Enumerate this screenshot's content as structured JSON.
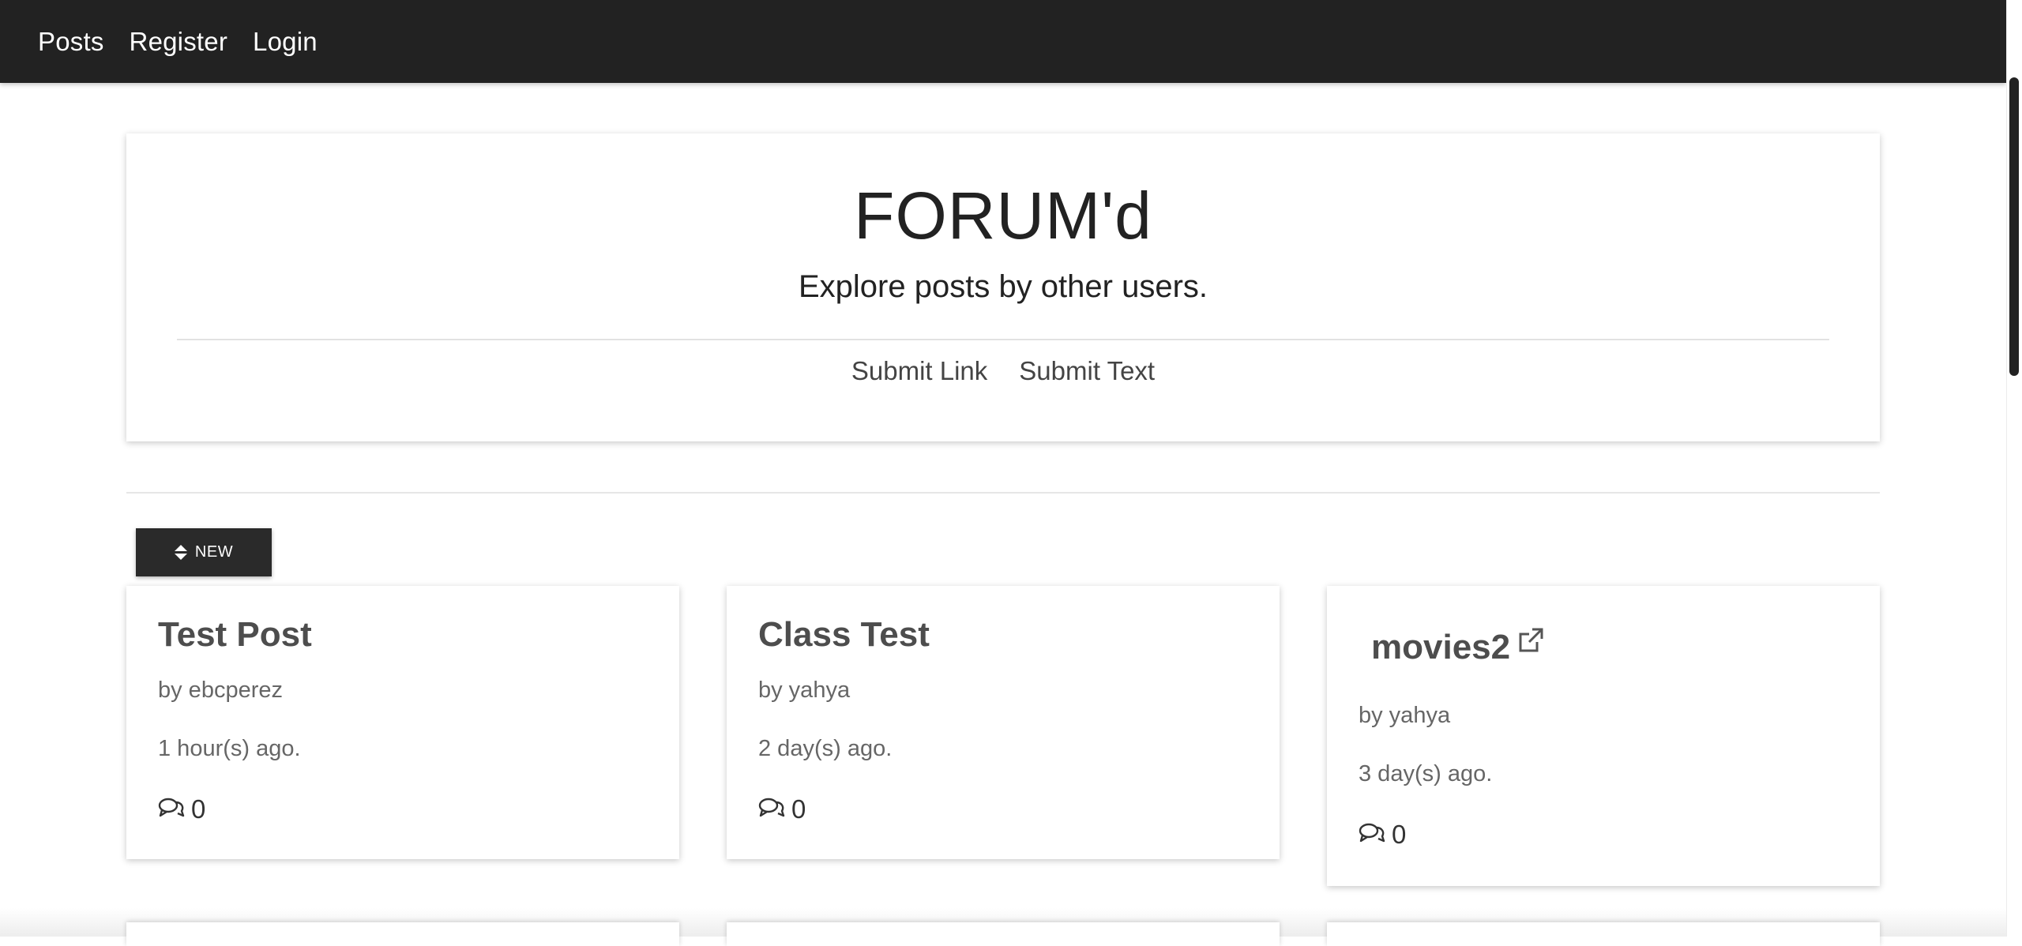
{
  "nav": {
    "items": [
      {
        "label": "Posts"
      },
      {
        "label": "Register"
      },
      {
        "label": "Login"
      }
    ]
  },
  "hero": {
    "title": "FORUM'd",
    "subtitle": "Explore posts by other users.",
    "actions": [
      {
        "label": "Submit Link"
      },
      {
        "label": "Submit Text"
      }
    ]
  },
  "sort": {
    "label": "NEW",
    "icon": "sort-icon"
  },
  "posts": [
    {
      "title": "Test Post",
      "author": "by ebcperez",
      "age": "1 hour(s) ago.",
      "comments": "0",
      "external": false
    },
    {
      "title": "Class Test",
      "author": "by yahya",
      "age": "2 day(s) ago.",
      "comments": "0",
      "external": false
    },
    {
      "title": "movies2",
      "author": "by yahya",
      "age": "3 day(s) ago.",
      "comments": "0",
      "external": true
    }
  ],
  "colors": {
    "navbar": "#222222",
    "button": "#2a2a2a",
    "text": "#222222",
    "muted": "#666666"
  }
}
